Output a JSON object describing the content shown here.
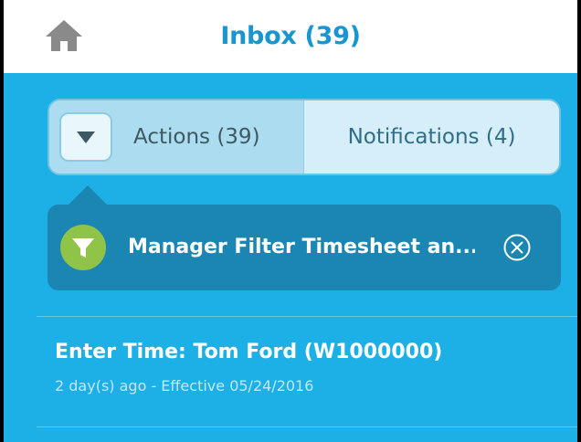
{
  "header": {
    "title": "Inbox (39)",
    "home_icon": "home-icon"
  },
  "tabs": [
    {
      "label": "Actions (39)",
      "selected": true,
      "dropdown_icon": "chevron-down-icon"
    },
    {
      "label": "Notifications (4)",
      "selected": false
    }
  ],
  "filter": {
    "icon": "funnel-icon",
    "label": "Manager Filter Timesheet an...",
    "clear_icon": "close-circle-icon"
  },
  "items": [
    {
      "title": "Enter Time: Tom Ford (W1000000)",
      "subtitle": "2 day(s) ago -  Effective 05/24/2016"
    }
  ],
  "colors": {
    "background": "#1DB0E6",
    "header_bg": "#FFFFFF",
    "title": "#1796D0",
    "filter_bar": "#1A86B1",
    "filter_icon": "#8FC449",
    "selected_tab": "#ABDCF0",
    "unselected_tab": "#D5EEF9"
  }
}
